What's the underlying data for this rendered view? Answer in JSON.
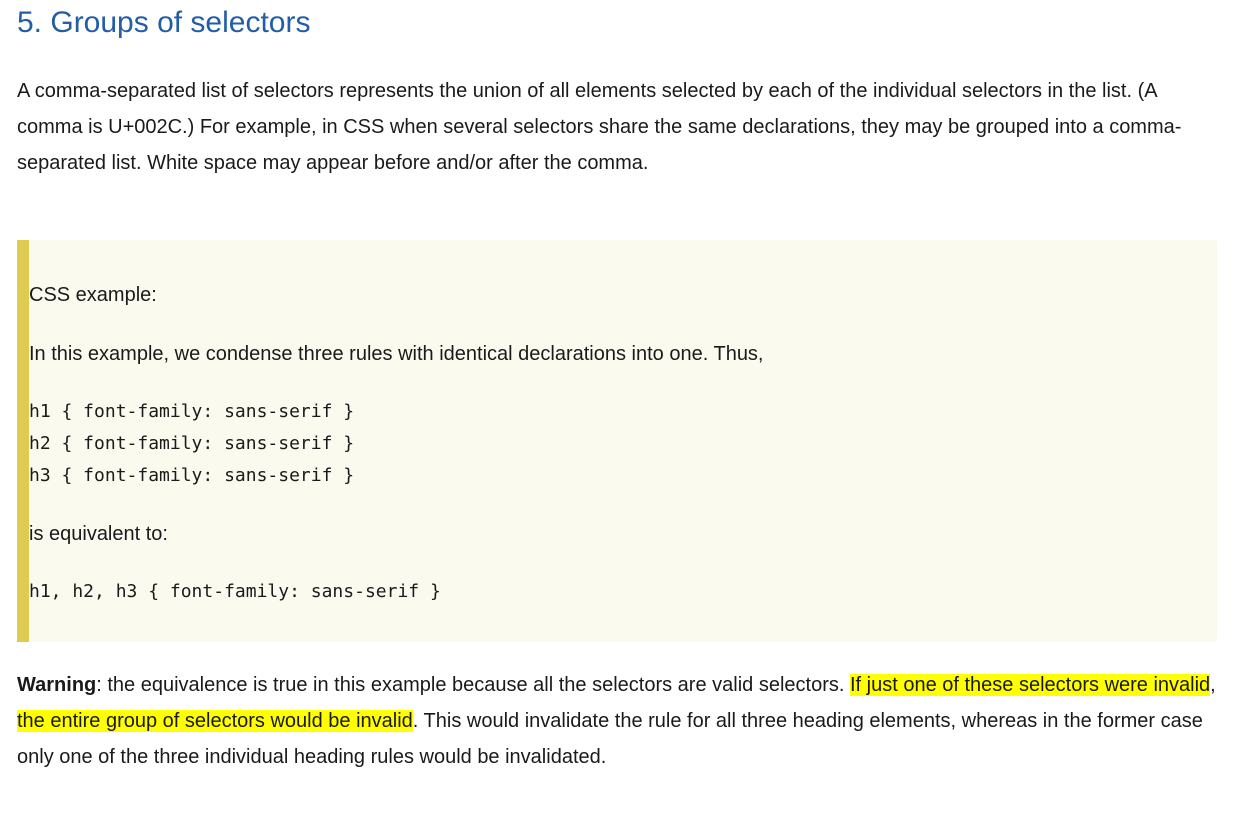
{
  "section": {
    "title": "5. Groups of selectors"
  },
  "intro": {
    "text": "A comma-separated list of selectors represents the union of all elements selected by each of the individual selectors in the list. (A comma is U+002C.) For example, in CSS when several selectors share the same declarations, they may be grouped into a comma-separated list. White space may appear before and/or after the comma."
  },
  "example": {
    "heading": "CSS example:",
    "description": "In this example, we condense three rules with identical declarations into one. Thus,",
    "code_before": "h1 { font-family: sans-serif }\nh2 { font-family: sans-serif }\nh3 { font-family: sans-serif }",
    "equivalent_label": "is equivalent to:",
    "code_after": "h1, h2, h3 { font-family: sans-serif }"
  },
  "warning": {
    "label": "Warning",
    "text_start": ": the equivalence is true in this example because all the selectors are valid selectors. ",
    "highlight_1": "If just one of these selectors were invalid",
    "separator": ", ",
    "highlight_2": "the entire group of selectors would be invalid",
    "text_end": ". This would invalidate the rule for all three heading elements, whereas in the former case only one of the three individual heading rules would be invalidated."
  },
  "colors": {
    "title": "#225ea8",
    "example_background": "#fbfaef",
    "example_border": "#e0cb52",
    "highlight": "#ffff00"
  }
}
